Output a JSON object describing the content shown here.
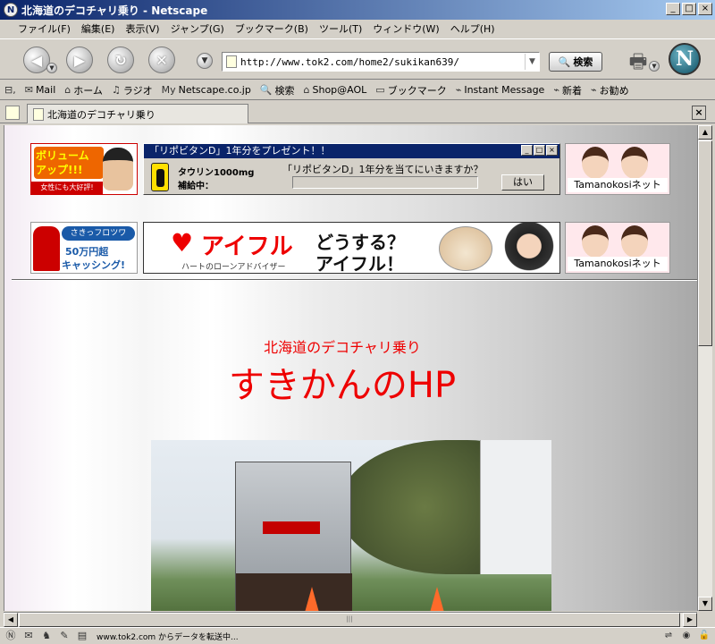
{
  "window": {
    "title": "北海道のデコチャリ乗り - Netscape",
    "app_icon": "N"
  },
  "menu": [
    "ファイル(F)",
    "編集(E)",
    "表示(V)",
    "ジャンプ(G)",
    "ブックマーク(B)",
    "ツール(T)",
    "ウィンドウ(W)",
    "ヘルプ(H)"
  ],
  "nav": {
    "url": "http://www.tok2.com/home2/sukikan639/",
    "search_label": "検索"
  },
  "personal_toolbar": {
    "items": [
      "Mail",
      "ホーム",
      "ラジオ",
      "Netscape.co.jp",
      "検索",
      "Shop@AOL",
      "ブックマーク",
      "Instant Message",
      "新着",
      "お勧め"
    ]
  },
  "tab": {
    "title": "北海道のデコチャリ乗り"
  },
  "ads": {
    "volume": {
      "headline": "ボリューム アップ!!!",
      "sub": "女性にも大好評!"
    },
    "popup": {
      "title": "「リポビタンD」1年分をプレゼント！！",
      "label1": "タウリン1000mg",
      "label2": "補給中：",
      "question": "「リポビタンD」1年分を当てにいきますか？",
      "yes": "はい"
    },
    "tamanokosi": "Tamanokosiネット",
    "cash": {
      "logo": "さきっフロツワ",
      "line1": "50万円超",
      "line2": "キャッシング!"
    },
    "aiful": {
      "brand": "アイフル",
      "tagline": "ハートのローンアドバイザー",
      "slogan1": "どうする？",
      "slogan2": "アイフル！"
    }
  },
  "page": {
    "subtitle": "北海道のデコチャリ乗り",
    "title": "すきかんのHP"
  },
  "status": {
    "text": "www.tok2.com からデータを転送中..."
  },
  "colors": {
    "title_red": "#ee0000",
    "titlebar": "#0a246a"
  }
}
